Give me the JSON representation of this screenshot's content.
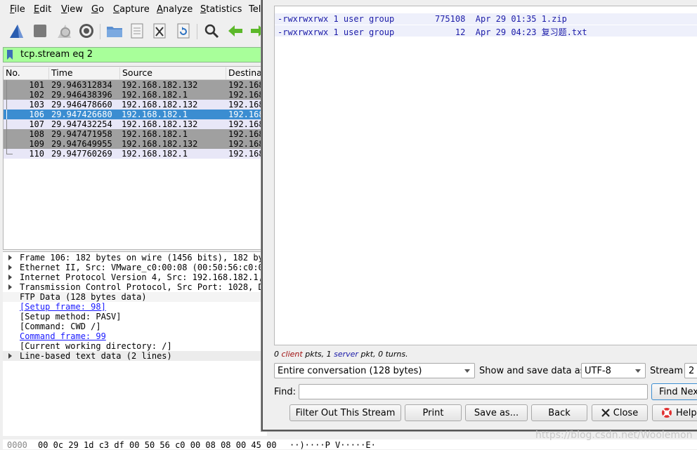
{
  "menu": [
    "File",
    "Edit",
    "View",
    "Go",
    "Capture",
    "Analyze",
    "Statistics",
    "Tele"
  ],
  "menu_mnemonic": [
    "F",
    "E",
    "V",
    "G",
    "C",
    "A",
    "S",
    ""
  ],
  "filter": {
    "value": "tcp.stream eq 2"
  },
  "packet_list": {
    "columns": [
      "No.",
      "Time",
      "Source",
      "Destinat"
    ],
    "rows": [
      {
        "no": "101",
        "time": "29.946312834",
        "src": "192.168.182.132",
        "dst": "192.168",
        "style": "dark"
      },
      {
        "no": "102",
        "time": "29.946438396",
        "src": "192.168.182.1",
        "dst": "192.168",
        "style": "dark"
      },
      {
        "no": "103",
        "time": "29.946478660",
        "src": "192.168.182.132",
        "dst": "192.168",
        "style": "light"
      },
      {
        "no": "106",
        "time": "29.947426680",
        "src": "192.168.182.1",
        "dst": "192.168",
        "style": "selected"
      },
      {
        "no": "107",
        "time": "29.947432254",
        "src": "192.168.182.132",
        "dst": "192.168",
        "style": "light"
      },
      {
        "no": "108",
        "time": "29.947471958",
        "src": "192.168.182.1",
        "dst": "192.168",
        "style": "dark"
      },
      {
        "no": "109",
        "time": "29.947649955",
        "src": "192.168.182.132",
        "dst": "192.168",
        "style": "dark"
      },
      {
        "no": "110",
        "time": "29.947760269",
        "src": "192.168.182.1",
        "dst": "192.168",
        "style": "light"
      }
    ]
  },
  "details": [
    {
      "text": "Frame 106: 182 bytes on wire (1456 bits), 182 by",
      "expand": true,
      "link": false
    },
    {
      "text": "Ethernet II, Src: VMware_c0:00:08 (00:50:56:c0:0",
      "expand": true,
      "link": false
    },
    {
      "text": "Internet Protocol Version 4, Src: 192.168.182.1,",
      "expand": true,
      "link": false
    },
    {
      "text": "Transmission Control Protocol, Src Port: 1028, D",
      "expand": true,
      "link": false
    },
    {
      "text": "FTP Data (128 bytes data)",
      "expand": false,
      "link": false
    },
    {
      "text": "[Setup frame: 98]",
      "expand": false,
      "link": true
    },
    {
      "text": "[Setup method: PASV]",
      "expand": false,
      "link": false
    },
    {
      "text": "[Command: CWD /]",
      "expand": false,
      "link": false
    },
    {
      "text": "Command frame: 99",
      "expand": false,
      "link": true
    },
    {
      "text": "[Current working directory: /]",
      "expand": false,
      "link": false
    },
    {
      "text": "Line-based text data (2 lines)",
      "expand": true,
      "link": false
    }
  ],
  "hex": {
    "offset": "0000",
    "bytes": "00 0c 29 1d c3 df 00 50  56 c0 00 08 08 00 45 00",
    "ascii": "··)····P V·····E·"
  },
  "stream_lines": [
    "-rwxrwxrwx 1 user group        775108  Apr 29 01:35 1.zip",
    "-rwxrwxrwx 1 user group            12  Apr 29 04:23 复习题.txt"
  ],
  "summary": {
    "count1": "0",
    "client": "client",
    "mid": "pkts,",
    "count2": "1",
    "server": "server",
    "tail": "pkt, 0 turns."
  },
  "conversation_select": "Entire conversation (128 bytes)",
  "show_save_label": "Show and save data as",
  "encoding_select": "UTF-8",
  "stream_label": "Stream",
  "stream_value": "2",
  "find_label": "Find:",
  "find_input": "",
  "buttons": {
    "find_next": "Find Next",
    "filter_out": "Filter Out This Stream",
    "print": "Print",
    "save_as": "Save as...",
    "back": "Back",
    "close": "Close",
    "help": "Help"
  },
  "watermark": "https://blog.csdn.net/Woolemon",
  "colors": {
    "selected": "#3b8dd1",
    "dark_row": "#a0a0a0",
    "light_row": "#e8e7f7",
    "filter_ok": "#a8ff9a"
  }
}
